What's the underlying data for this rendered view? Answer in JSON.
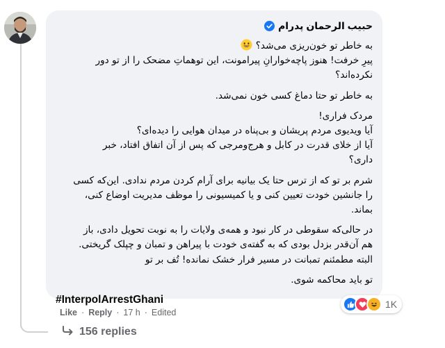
{
  "comment": {
    "author": "حبیب الرحمان پدرام",
    "verified": true,
    "paragraphs": [
      [
        "به خاطر تو خون‌ریزی می‌شد؟"
      ],
      [
        "پیرِ خرفت! هنوز پاچه‌خوارانِ پیرامونت، این توهماتِ مضحک را از تو دور",
        "نکرده‌اند؟"
      ],
      [
        "به خاطر تو حتا دماغ کسی خون نمی‌شد."
      ],
      [
        "مردک فراری!"
      ],
      [
        "آیا ویدیوی مردم پریشان و بی‌پناه در میدان هوایی را دیده‌ای؟"
      ],
      [
        "آیا از خلای قدرت در کابل و هرج‌ومرجی که پس از آن اتفاق افتاد، خبر",
        "داری؟"
      ],
      [
        "شرم بر تو که از ترس حتا یک بیانیه برای آرام کردن مردم ندادی. این‌که کسی",
        "را جانشین خودت تعیین کنی و یا کمیسیونی را موظف مدیریت اوضاع کنی،",
        "بماند."
      ],
      [
        "در حالی‌که سقوطی در کار نبود و همه‌ی ولایات را به نوبت تحویل دادی، باز",
        "هم آن‌قدر بزدل بودی که به گفته‌ی خودت با پیراهن و تمبان و چپلک گریختی.",
        "البته مطمئنم تمبانت در مسیر فرار خشک نمانده! تُف بر تو"
      ],
      [
        "تو باید محاکمه شوی."
      ]
    ],
    "hashtag": "#InterpolArrestGhani",
    "reactions": {
      "icons": [
        "like-icon",
        "love-icon",
        "haha-icon"
      ],
      "count": "1K",
      "colors": {
        "like": "#1877f2",
        "love": "#f33e58",
        "haha": "#f7b125"
      }
    }
  },
  "actions": {
    "like": "Like",
    "reply": "Reply",
    "time": "17 h",
    "edited": "Edited",
    "separator": "·"
  },
  "replies": {
    "label": "156 replies"
  }
}
